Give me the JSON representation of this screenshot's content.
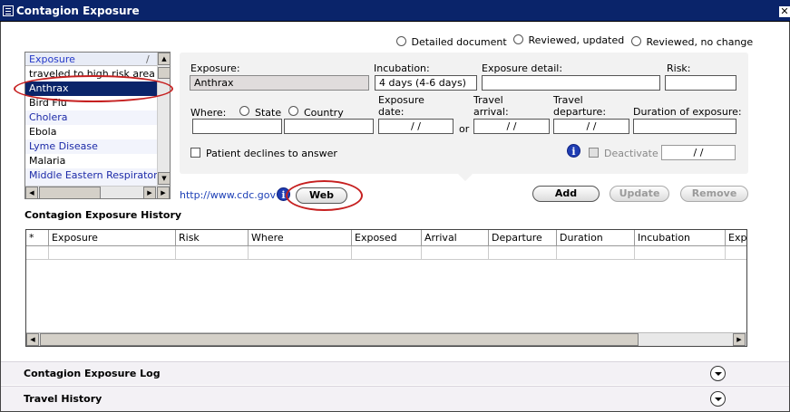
{
  "window": {
    "title": "Contagion Exposure",
    "close_glyph": "✕"
  },
  "review_options": [
    {
      "label": "Detailed document"
    },
    {
      "label": "Reviewed, updated"
    },
    {
      "label": "Reviewed, no change"
    }
  ],
  "exposure_list": {
    "header": "Exposure",
    "sort_glyph": "/",
    "items": [
      "traveled to high risk area",
      "Anthrax",
      "Bird Flu",
      "Cholera",
      "Ebola",
      "Lyme Disease",
      "Malaria",
      "Middle Eastern Respiratory Syndrome (MERS)"
    ],
    "selected": "Anthrax"
  },
  "form": {
    "exposure_label": "Exposure:",
    "exposure_value": "Anthrax",
    "incubation_label": "Incubation:",
    "incubation_value": "4 days (4-6 days)",
    "exposure_detail_label": "Exposure detail:",
    "exposure_detail_value": "",
    "risk_label": "Risk:",
    "risk_value": "",
    "where_label": "Where:",
    "where_state": "State",
    "where_country": "Country",
    "exposure_date_label": "Exposure date:",
    "exposure_date_value": "/ /",
    "or_label": "or",
    "travel_arrival_label": "Travel arrival:",
    "travel_arrival_value": "/ /",
    "travel_departure_label": "Travel departure:",
    "travel_departure_value": "/ /",
    "duration_label": "Duration of exposure:",
    "duration_value": "",
    "declines_label": "Patient declines to answer",
    "deactivate_label": "Deactivate",
    "deactivate_date": "/ /",
    "info_glyph": "i"
  },
  "link": {
    "cdc_url": "http://www.cdc.gov"
  },
  "buttons": {
    "web": "Web",
    "add": "Add",
    "update": "Update",
    "remove": "Remove"
  },
  "history": {
    "title": "Contagion Exposure History",
    "columns": [
      "*",
      "Exposure",
      "Risk",
      "Where",
      "Exposed",
      "Arrival",
      "Departure",
      "Duration",
      "Incubation",
      "Expo"
    ],
    "rows": []
  },
  "sections": [
    {
      "label": "Contagion Exposure Log"
    },
    {
      "label": "Travel History"
    }
  ],
  "colors": {
    "titlebar": "#0a246a",
    "selection": "#0a246a",
    "annotation": "#c62020",
    "link": "#1c3fb6"
  }
}
